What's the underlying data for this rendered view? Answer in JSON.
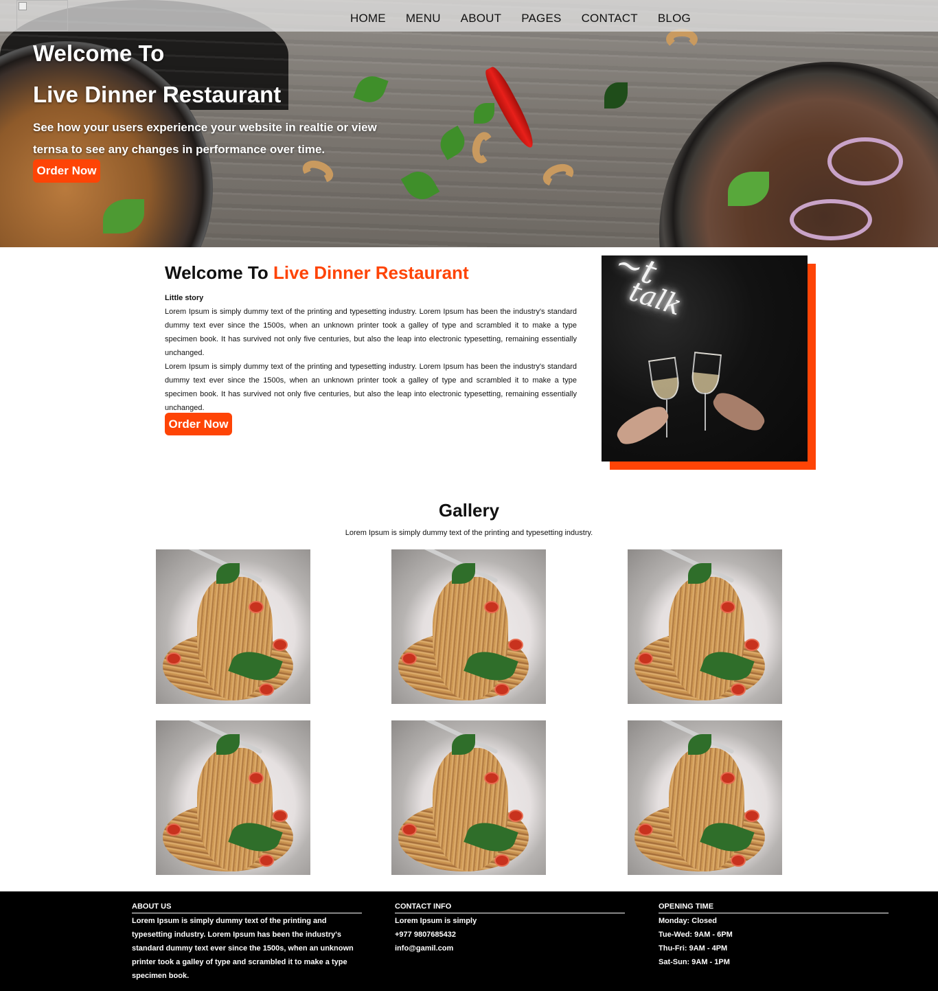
{
  "nav": {
    "logo_alt": "",
    "items": [
      "HOME",
      "MENU",
      "ABOUT",
      "PAGES",
      "CONTACT",
      "BLOG"
    ]
  },
  "hero": {
    "title_line1": "Welcome To",
    "title_line2": "Live Dinner Restaurant",
    "subtitle": "See how your users experience your website in realtie or view ternsa to see any changes in performance over time.",
    "button": "Order Now"
  },
  "about": {
    "title_prefix": "Welcome To",
    "title_accent": "Live Dinner Restaurant",
    "subheading": "Little story",
    "paragraph1": "Lorem Ipsum is simply dummy text of the printing and typesetting industry. Lorem Ipsum has been the industry's standard dummy text ever since the 1500s, when an unknown printer took a galley of type and scrambled it to make a type specimen book. It has survived not only five centuries, but also the leap into electronic typesetting, remaining essentially unchanged.",
    "paragraph2": "Lorem Ipsum is simply dummy text of the printing and typesetting industry. Lorem Ipsum has been the industry's standard dummy text ever since the 1500s, when an unknown printer took a galley of type and scrambled it to make a type specimen book. It has survived not only five centuries, but also the leap into electronic typesetting, remaining essentially unchanged.",
    "button": "Order Now"
  },
  "gallery": {
    "title": "Gallery",
    "subtitle": "Lorem Ipsum is simply dummy text of the printing and typesetting industry.",
    "count": 6
  },
  "footer": {
    "about": {
      "heading": "ABOUT US",
      "text": "Lorem Ipsum is simply dummy text of the printing and typesetting industry. Lorem Ipsum has been the industry's standard dummy text ever since the 1500s, when an unknown printer took a galley of type and scrambled it to make a type specimen book."
    },
    "contact": {
      "heading": "CONTACT INFO",
      "lines": [
        "Lorem Ipsum is simply",
        "+977 9807685432",
        "info@gamil.com"
      ]
    },
    "hours": {
      "heading": "OPENING TIME",
      "lines": [
        "Monday: Closed",
        "Tue-Wed: 9AM - 6PM",
        "Thu-Fri: 9AM - 4PM",
        "Sat-Sun: 9AM - 1PM"
      ]
    }
  },
  "colors": {
    "accent": "#fe4406",
    "footer_bg": "#000000"
  }
}
